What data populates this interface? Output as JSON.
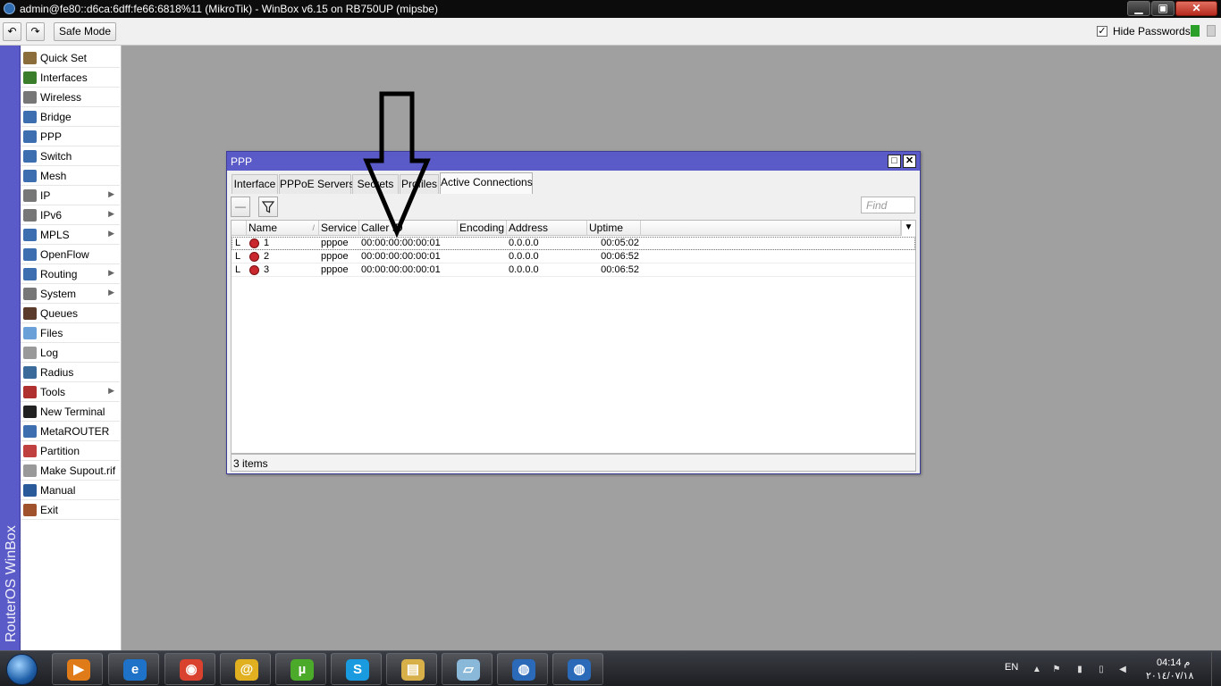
{
  "window": {
    "title": "admin@fe80::d6ca:6dff:fe66:6818%11 (MikroTik) - WinBox v6.15 on RB750UP (mipsbe)",
    "min": "▁",
    "max": "▣",
    "close": "✕"
  },
  "toolbar": {
    "undo": "↶",
    "redo": "↷",
    "safe_mode": "Safe Mode",
    "hide_passwords": "Hide Passwords",
    "hide_passwords_checked": "✓"
  },
  "brand": "RouterOS WinBox",
  "sidebar": {
    "items": [
      {
        "label": "Quick Set",
        "icon": "quickset-icon",
        "color": "#8a6d3b",
        "submenu": false
      },
      {
        "label": "Interfaces",
        "icon": "interfaces-icon",
        "color": "#3a7d2a",
        "submenu": false
      },
      {
        "label": "Wireless",
        "icon": "wireless-icon",
        "color": "#777777",
        "submenu": false
      },
      {
        "label": "Bridge",
        "icon": "bridge-icon",
        "color": "#3d6fb0",
        "submenu": false
      },
      {
        "label": "PPP",
        "icon": "ppp-icon",
        "color": "#3d6fb0",
        "submenu": false
      },
      {
        "label": "Switch",
        "icon": "switch-icon",
        "color": "#3d6fb0",
        "submenu": false
      },
      {
        "label": "Mesh",
        "icon": "mesh-icon",
        "color": "#3d6fb0",
        "submenu": false
      },
      {
        "label": "IP",
        "icon": "ip-icon",
        "color": "#777777",
        "submenu": true
      },
      {
        "label": "IPv6",
        "icon": "ipv6-icon",
        "color": "#777777",
        "submenu": true
      },
      {
        "label": "MPLS",
        "icon": "mpls-icon",
        "color": "#3d6fb0",
        "submenu": true
      },
      {
        "label": "OpenFlow",
        "icon": "openflow-icon",
        "color": "#3d6fb0",
        "submenu": false
      },
      {
        "label": "Routing",
        "icon": "routing-icon",
        "color": "#3d6fb0",
        "submenu": true
      },
      {
        "label": "System",
        "icon": "system-icon",
        "color": "#777777",
        "submenu": true
      },
      {
        "label": "Queues",
        "icon": "queues-icon",
        "color": "#5a3a2a",
        "submenu": false
      },
      {
        "label": "Files",
        "icon": "files-icon",
        "color": "#6aa0d8",
        "submenu": false
      },
      {
        "label": "Log",
        "icon": "log-icon",
        "color": "#999999",
        "submenu": false
      },
      {
        "label": "Radius",
        "icon": "radius-icon",
        "color": "#3a6a9a",
        "submenu": false
      },
      {
        "label": "Tools",
        "icon": "tools-icon",
        "color": "#b03030",
        "submenu": true
      },
      {
        "label": "New Terminal",
        "icon": "terminal-icon",
        "color": "#222222",
        "submenu": false
      },
      {
        "label": "MetaROUTER",
        "icon": "metarouter-icon",
        "color": "#3d6fb0",
        "submenu": false
      },
      {
        "label": "Partition",
        "icon": "partition-icon",
        "color": "#c04040",
        "submenu": false
      },
      {
        "label": "Make Supout.rif",
        "icon": "supout-icon",
        "color": "#999999",
        "submenu": false
      },
      {
        "label": "Manual",
        "icon": "manual-icon",
        "color": "#2a5a9a",
        "submenu": false
      },
      {
        "label": "Exit",
        "icon": "exit-icon",
        "color": "#a0522d",
        "submenu": false
      }
    ]
  },
  "ppp": {
    "title": "PPP",
    "max_glyph": "□",
    "close_glyph": "✕",
    "tabs": [
      {
        "label": "Interface",
        "active": false
      },
      {
        "label": "PPPoE Servers",
        "active": false
      },
      {
        "label": "Secrets",
        "active": false
      },
      {
        "label": "Profiles",
        "active": false
      },
      {
        "label": "Active Connections",
        "active": true
      }
    ],
    "remove_glyph": "—",
    "filter_glyph": "⏷",
    "find_placeholder": "Find",
    "columns": [
      "",
      "Name",
      "Service",
      "Caller ID",
      "Encoding",
      "Address",
      "Uptime"
    ],
    "menu_glyph": "▼",
    "rows": [
      {
        "flag": "L",
        "name": "1",
        "service": "pppoe",
        "caller_id": "00:00:00:00:00:01",
        "encoding": "",
        "address": "0.0.0.0",
        "uptime": "00:05:02"
      },
      {
        "flag": "L",
        "name": "2",
        "service": "pppoe",
        "caller_id": "00:00:00:00:00:01",
        "encoding": "",
        "address": "0.0.0.0",
        "uptime": "00:06:52"
      },
      {
        "flag": "L",
        "name": "3",
        "service": "pppoe",
        "caller_id": "00:00:00:00:00:01",
        "encoding": "",
        "address": "0.0.0.0",
        "uptime": "00:06:52"
      }
    ],
    "status": "3 items"
  },
  "taskbar": {
    "apps": [
      {
        "name": "media-player",
        "glyph": "▶",
        "color": "#e07b1a"
      },
      {
        "name": "internet-explorer",
        "glyph": "e",
        "color": "#1e73c8"
      },
      {
        "name": "chrome",
        "glyph": "◉",
        "color": "#d8422e"
      },
      {
        "name": "email",
        "glyph": "@",
        "color": "#e0b020"
      },
      {
        "name": "utorrent",
        "glyph": "µ",
        "color": "#4caa2a"
      },
      {
        "name": "skype",
        "glyph": "S",
        "color": "#1a9be0"
      },
      {
        "name": "file-explorer",
        "glyph": "▤",
        "color": "#d8b04a"
      },
      {
        "name": "notepad",
        "glyph": "▱",
        "color": "#8ab8d8"
      },
      {
        "name": "winbox-1",
        "glyph": "◍",
        "color": "#2a6ab8"
      },
      {
        "name": "winbox-2",
        "glyph": "◍",
        "color": "#2a6ab8"
      }
    ],
    "language": "EN",
    "time": "04:14 م",
    "date": "٢٠١٤/٠٧/١٨"
  }
}
